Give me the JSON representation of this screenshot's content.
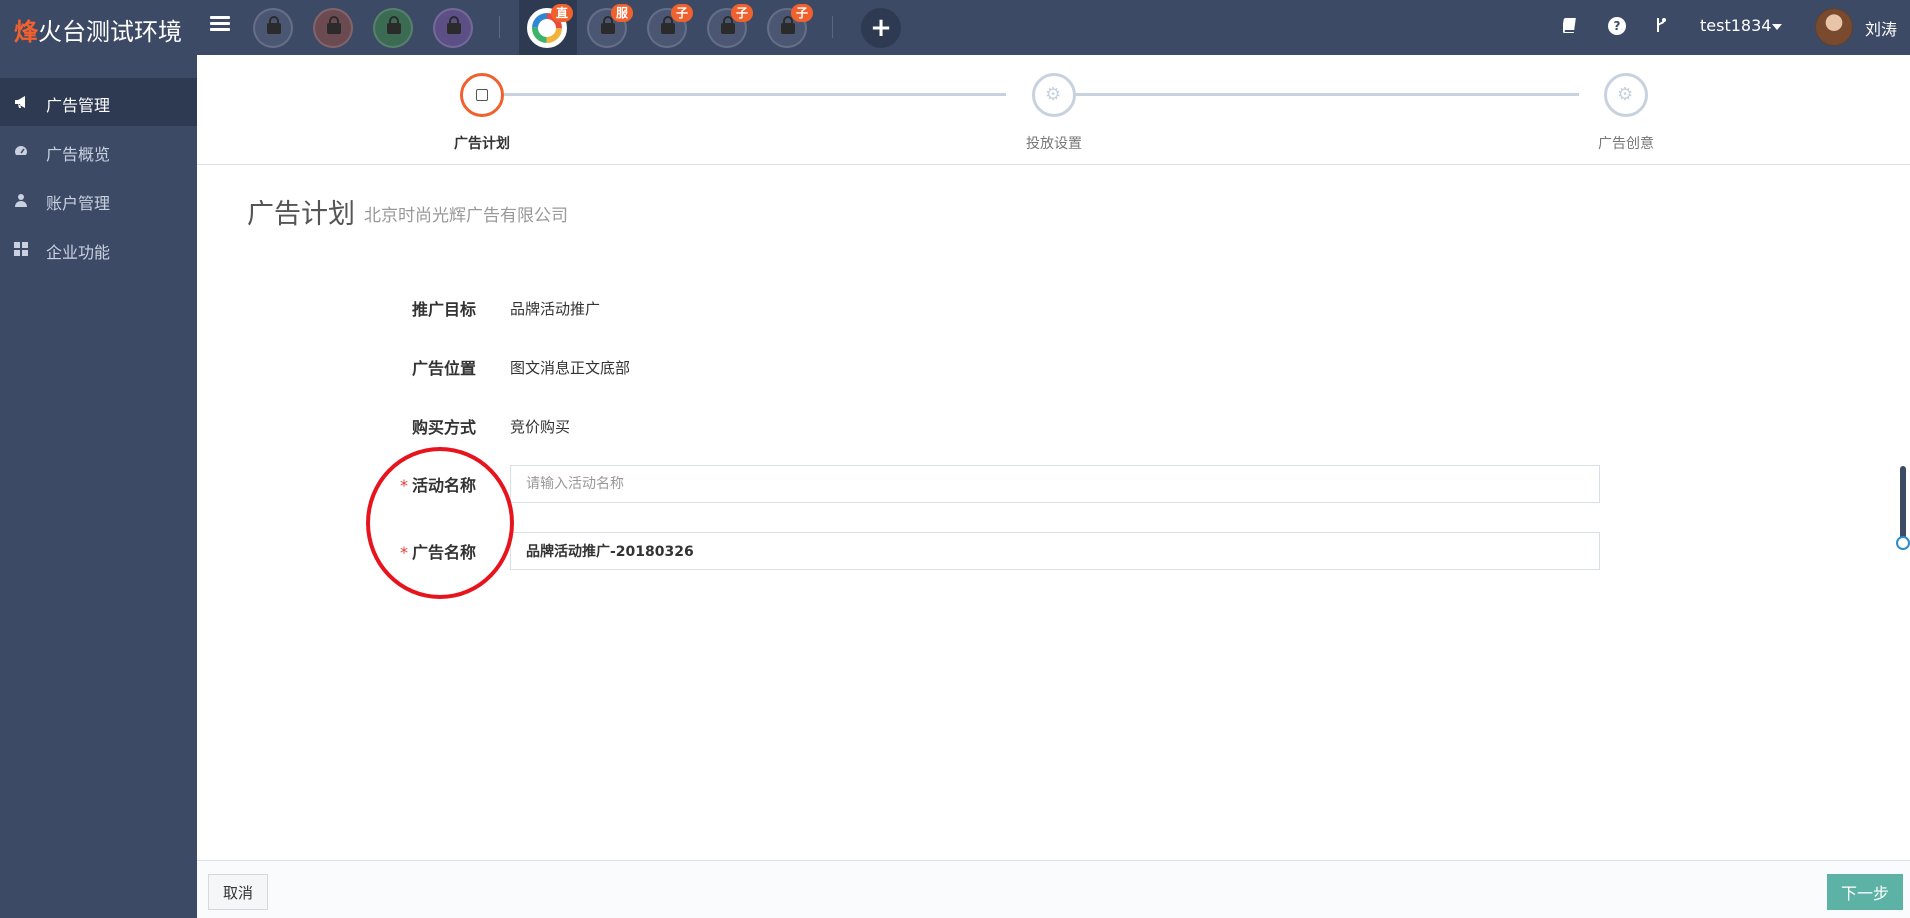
{
  "app": {
    "brand_accent": "烽",
    "brand_rest": "火台测试环境"
  },
  "topbar": {
    "menu_icon": "hamburger-menu-icon",
    "apps": [
      {
        "name": "locked-app-1",
        "badge": "",
        "color": "#4a5672"
      },
      {
        "name": "locked-app-2",
        "badge": "",
        "color": "#6b4a52"
      },
      {
        "name": "locked-app-3",
        "badge": "",
        "color": "#3b6b52"
      },
      {
        "name": "locked-app-4",
        "badge": "",
        "color": "#5c4f86"
      },
      {
        "name": "active-app",
        "badge": "直",
        "color": "#ffffff"
      },
      {
        "name": "locked-app-5",
        "badge": "服",
        "color": "#4a5672"
      },
      {
        "name": "locked-app-6",
        "badge": "子",
        "color": "#4a5672"
      },
      {
        "name": "locked-app-7",
        "badge": "子",
        "color": "#4a5672"
      },
      {
        "name": "locked-app-8",
        "badge": "子",
        "color": "#4a5672"
      }
    ],
    "add_label": "+",
    "user_name": "test1834",
    "avatar_name": "刘涛"
  },
  "sidebar": {
    "items": [
      {
        "label": "广告管理",
        "icon": "megaphone-icon",
        "active": true
      },
      {
        "label": "广告概览",
        "icon": "dashboard-icon",
        "active": false
      },
      {
        "label": "账户管理",
        "icon": "user-icon",
        "active": false
      },
      {
        "label": "企业功能",
        "icon": "grid-icon",
        "active": false
      }
    ]
  },
  "steps": [
    {
      "label": "广告计划",
      "state": "current"
    },
    {
      "label": "投放设置",
      "state": "pending"
    },
    {
      "label": "广告创意",
      "state": "pending"
    }
  ],
  "page": {
    "title": "广告计划",
    "subtitle": "北京时尚光辉广告有限公司"
  },
  "form": {
    "rows": [
      {
        "label": "推广目标",
        "value": "品牌活动推广"
      },
      {
        "label": "广告位置",
        "value": "图文消息正文底部"
      },
      {
        "label": "购买方式",
        "value": "竞价购买"
      }
    ],
    "campaign_name": {
      "label": "活动名称",
      "required": "*",
      "value": "",
      "placeholder": "请输入活动名称"
    },
    "ad_name": {
      "label": "广告名称",
      "required": "*",
      "value": "品牌活动推广-20180326"
    }
  },
  "footer": {
    "cancel_label": "取消",
    "next_label": "下一步"
  },
  "colors": {
    "navy": "#3d4a66",
    "accent": "#f0612e",
    "next_button": "#5cb3a5",
    "annotation": "#e8141d"
  }
}
